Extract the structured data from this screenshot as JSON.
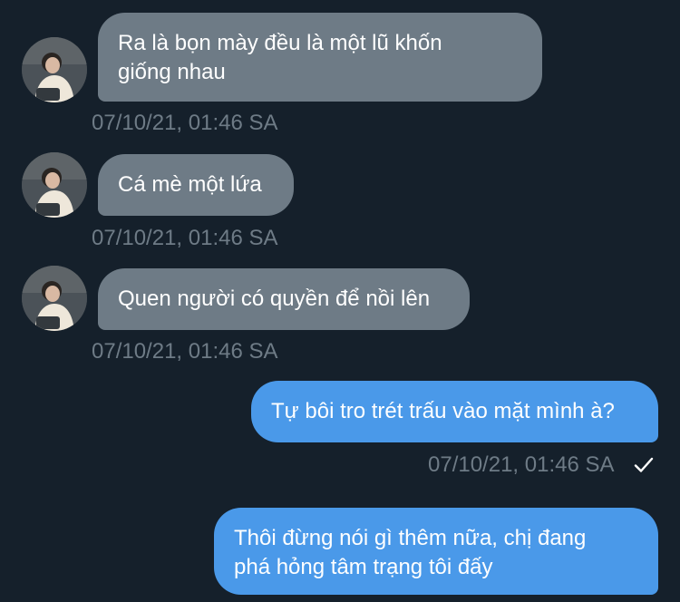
{
  "messages": [
    {
      "direction": "incoming",
      "text": "Ra là bọn mày đều là một lũ khốn giống nhau",
      "line1": "Ra là bọn mày đều là một lũ khốn",
      "line2": "giống nhau",
      "timestamp": "07/10/21, 01:46 SA"
    },
    {
      "direction": "incoming",
      "text": "Cá mè một lứa",
      "timestamp": "07/10/21, 01:46 SA"
    },
    {
      "direction": "incoming",
      "text": "Quen người có quyền để nồi lên",
      "timestamp": "07/10/21, 01:46 SA"
    },
    {
      "direction": "outgoing",
      "text": "Tự bôi tro trét trấu vào mặt mình à?",
      "timestamp": "07/10/21, 01:46 SA",
      "status_icon": "checkmark-icon"
    },
    {
      "direction": "outgoing",
      "text": "Thôi đừng nói gì thêm nữa, chị đang phá hỏng tâm trạng tôi đấy",
      "line1": "Thôi đừng nói gì thêm nữa, chị đang",
      "line2": "phá hỏng tâm trạng tôi đấy"
    }
  ],
  "colors": {
    "background": "#15202b",
    "incoming_bubble": "#6e7b86",
    "outgoing_bubble": "#4a99e9",
    "timestamp": "#6e7b86"
  }
}
